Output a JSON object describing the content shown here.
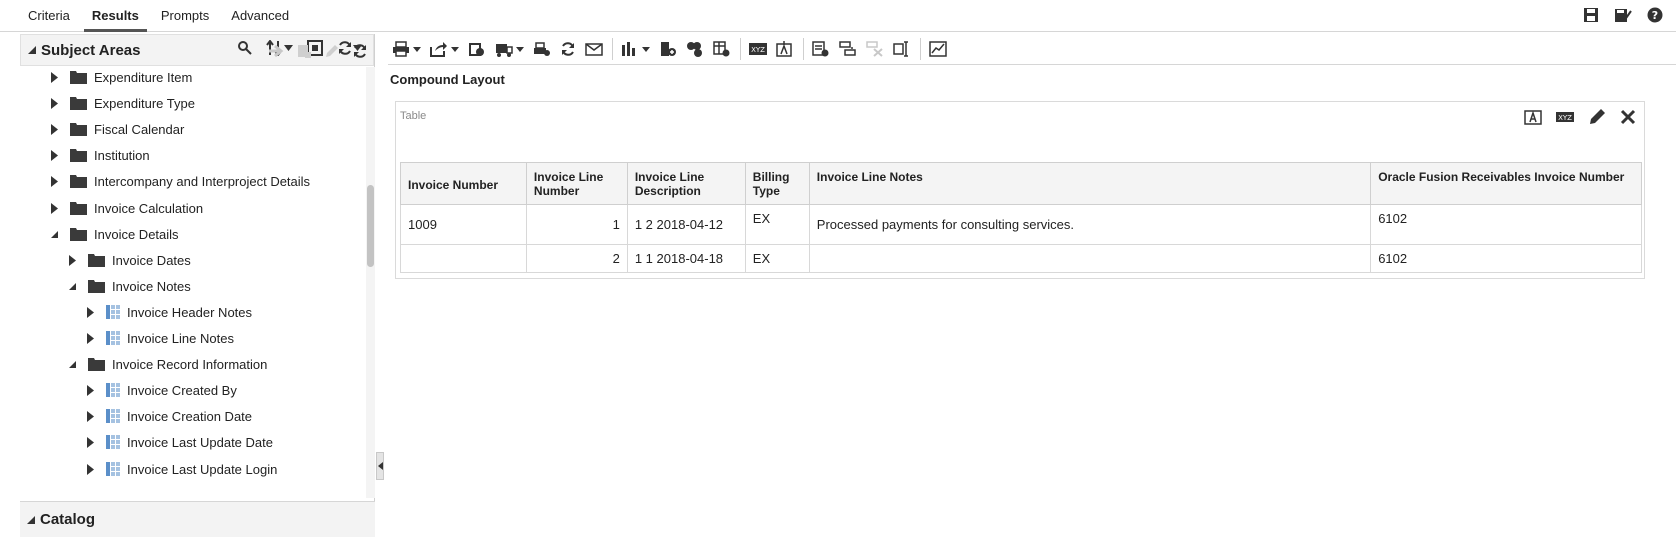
{
  "top_tabs": [
    {
      "label": "Criteria"
    },
    {
      "label": "Results"
    },
    {
      "label": "Prompts"
    },
    {
      "label": "Advanced"
    }
  ],
  "subject_areas": {
    "title": "Subject Areas",
    "tree": [
      {
        "label": "Expenditure Item",
        "level": 1,
        "expanded": false,
        "icon": "folder-icon"
      },
      {
        "label": "Expenditure Type",
        "level": 1,
        "expanded": false,
        "icon": "folder-icon"
      },
      {
        "label": "Fiscal Calendar",
        "level": 1,
        "expanded": false,
        "icon": "folder-icon"
      },
      {
        "label": "Institution",
        "level": 1,
        "expanded": false,
        "icon": "folder-icon"
      },
      {
        "label": "Intercompany and Interproject Details",
        "level": 1,
        "expanded": false,
        "icon": "folder-icon"
      },
      {
        "label": "Invoice Calculation",
        "level": 1,
        "expanded": false,
        "icon": "folder-icon"
      },
      {
        "label": "Invoice Details",
        "level": 1,
        "expanded": true,
        "icon": "folder-icon"
      },
      {
        "label": "Invoice Dates",
        "level": 2,
        "expanded": false,
        "icon": "folder-icon"
      },
      {
        "label": "Invoice Notes",
        "level": 2,
        "expanded": true,
        "icon": "folder-icon"
      },
      {
        "label": "Invoice Header Notes",
        "level": 3,
        "expanded": false,
        "icon": "column-icon"
      },
      {
        "label": "Invoice Line Notes",
        "level": 3,
        "expanded": false,
        "icon": "column-icon"
      },
      {
        "label": "Invoice Record Information",
        "level": 2,
        "expanded": true,
        "icon": "folder-icon"
      },
      {
        "label": "Invoice Created By",
        "level": 3,
        "expanded": false,
        "icon": "column-icon"
      },
      {
        "label": "Invoice Creation Date",
        "level": 3,
        "expanded": false,
        "icon": "column-icon"
      },
      {
        "label": "Invoice Last Update Date",
        "level": 3,
        "expanded": false,
        "icon": "column-icon"
      },
      {
        "label": "Invoice Last Update Login",
        "level": 3,
        "expanded": false,
        "icon": "column-icon"
      }
    ]
  },
  "catalog": {
    "title": "Catalog"
  },
  "compound_layout": {
    "title": "Compound Layout"
  },
  "table_view": {
    "label": "Table",
    "columns": [
      "Invoice Number",
      "Invoice Line Number",
      "Invoice Line Description",
      "Billing Type",
      "Invoice Line Notes",
      "Oracle Fusion Receivables Invoice Number"
    ],
    "rows": [
      {
        "invoice_number": "1009",
        "line_number": "1",
        "description": "1 2 2018-04-12",
        "billing_type": "EX",
        "notes": "Processed payments for consulting services.",
        "receivables_number": "6102"
      },
      {
        "invoice_number": "",
        "line_number": "2",
        "description": "1 1 2018-04-18",
        "billing_type": "EX",
        "notes": "",
        "receivables_number": "6102"
      }
    ]
  },
  "colors": {
    "column_icon": "#5b8fc9",
    "folder": "#3a3a3a"
  }
}
